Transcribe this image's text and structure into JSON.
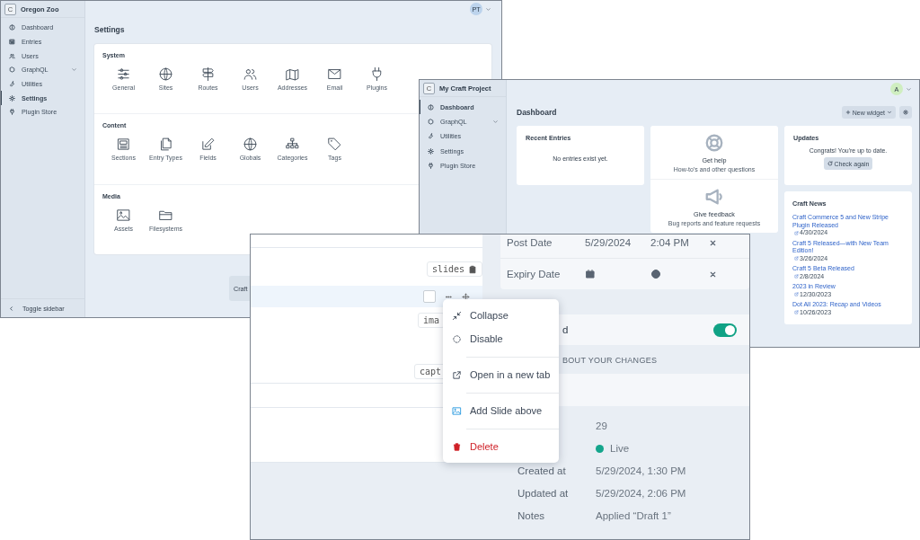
{
  "settings_window": {
    "logo": "C",
    "site_name": "Oregon Zoo",
    "avatar": "PT",
    "nav": [
      {
        "label": "Dashboard",
        "selected": false,
        "has_submenu": false
      },
      {
        "label": "Entries",
        "selected": false,
        "has_submenu": false
      },
      {
        "label": "Users",
        "selected": false,
        "has_submenu": false
      },
      {
        "label": "GraphQL",
        "selected": false,
        "has_submenu": true
      },
      {
        "label": "Utilities",
        "selected": false,
        "has_submenu": false
      },
      {
        "label": "Settings",
        "selected": true,
        "has_submenu": false
      },
      {
        "label": "Plugin Store",
        "selected": false,
        "has_submenu": false
      }
    ],
    "toggle_sidebar": "Toggle sidebar",
    "title": "Settings",
    "sections": [
      {
        "heading": "System",
        "items": [
          "General",
          "Sites",
          "Routes",
          "Users",
          "Addresses",
          "Email",
          "Plugins"
        ]
      },
      {
        "heading": "Content",
        "items": [
          "Sections",
          "Entry Types",
          "Fields",
          "Globals",
          "Categories",
          "Tags"
        ]
      },
      {
        "heading": "Media",
        "items": [
          "Assets",
          "Filesystems"
        ]
      }
    ],
    "button": "Craft"
  },
  "dashboard_window": {
    "logo": "C",
    "site_name": "My Craft Project",
    "avatar": "A",
    "nav": [
      {
        "label": "Dashboard",
        "selected": true,
        "has_submenu": false
      },
      {
        "label": "GraphQL",
        "selected": false,
        "has_submenu": true
      },
      {
        "label": "Utilities",
        "selected": false,
        "has_submenu": false
      },
      {
        "label": "Settings",
        "selected": false,
        "has_submenu": false
      },
      {
        "label": "Plugin Store",
        "selected": false,
        "has_submenu": false
      }
    ],
    "title": "Dashboard",
    "new_widget": "New widget",
    "recent_entries": {
      "title": "Recent Entries",
      "message": "No entries exist yet."
    },
    "help": {
      "title": "Get help",
      "subtitle": "How-to's and other questions"
    },
    "feedback": {
      "title": "Give feedback",
      "subtitle": "Bug reports and feature requests"
    },
    "updates": {
      "title": "Updates",
      "message": "Congrats! You're up to date.",
      "button": "Check again"
    },
    "news": {
      "title": "Craft News",
      "items": [
        {
          "title": "Craft Commerce 5 and New Stripe Plugin Released",
          "date": "4/30/2024"
        },
        {
          "title": "Craft 5 Released—with New Team Edition!",
          "date": "3/26/2024"
        },
        {
          "title": "Craft 5 Beta Released",
          "date": "2/8/2024"
        },
        {
          "title": "2023 in Review",
          "date": "12/30/2023"
        },
        {
          "title": "Dot All 2023: Recap and Videos",
          "date": "10/26/2023"
        }
      ]
    }
  },
  "entry_window": {
    "handle_badge": "slides",
    "block_checked": false,
    "block_badges": [
      "ima",
      "capt"
    ],
    "dates": [
      {
        "label": "Post Date",
        "date": "5/29/2024",
        "time": "2:04 PM"
      },
      {
        "label": "Expiry Date"
      }
    ],
    "toggle": {
      "label": "d",
      "on": true
    },
    "notes_heading": "BOUT YOUR CHANGES",
    "meta": [
      {
        "kind": "text",
        "value": "29"
      },
      {
        "kind": "status",
        "value": "Live",
        "color": "#14a58c"
      },
      {
        "kind": "text",
        "label": "Created at",
        "value": "5/29/2024, 1:30 PM"
      },
      {
        "kind": "text",
        "label": "Updated at",
        "value": "5/29/2024, 2:06 PM"
      },
      {
        "kind": "text",
        "label": "Notes",
        "value": "Applied “Draft 1”"
      }
    ],
    "menu": [
      {
        "label": "Collapse",
        "kind": "collapse",
        "divider_before": false
      },
      {
        "label": "Disable",
        "kind": "disable",
        "divider_before": false
      },
      {
        "label": "Open in a new tab",
        "kind": "external",
        "divider_before": true
      },
      {
        "label": "Add Slide above",
        "kind": "image",
        "divider_before": true
      },
      {
        "label": "Delete",
        "kind": "delete",
        "divider_before": true
      }
    ]
  }
}
